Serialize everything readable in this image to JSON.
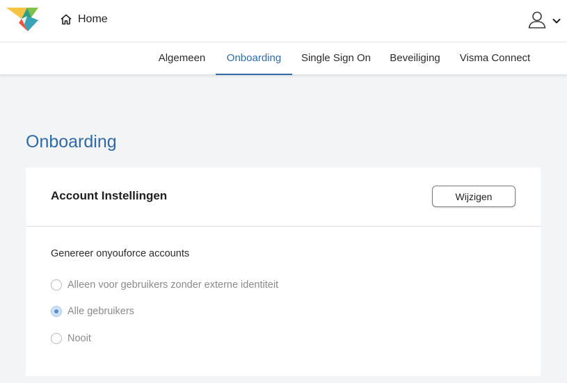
{
  "header": {
    "logo_icon": "visma-logo",
    "home_label": "Home",
    "home_icon": "home-icon",
    "user_icon": "user-icon",
    "dropdown_icon": "chevron-down-icon"
  },
  "tabs": [
    {
      "label": "Algemeen",
      "active": false
    },
    {
      "label": "Onboarding",
      "active": true
    },
    {
      "label": "Single Sign On",
      "active": false
    },
    {
      "label": "Beveiliging",
      "active": false
    },
    {
      "label": "Visma Connect",
      "active": false
    }
  ],
  "page": {
    "title": "Onboarding"
  },
  "card": {
    "title": "Account Instellingen",
    "edit_label": "Wijzigen",
    "section_label": "Genereer onyouforce accounts",
    "options": [
      {
        "label": "Alleen voor gebruikers zonder externe identiteit",
        "checked": false
      },
      {
        "label": "Alle gebruikers",
        "checked": true
      },
      {
        "label": "Nooit",
        "checked": false
      }
    ]
  },
  "colors": {
    "accent": "#2f6aa6",
    "background": "#f3f4f5",
    "card": "#ffffff"
  }
}
